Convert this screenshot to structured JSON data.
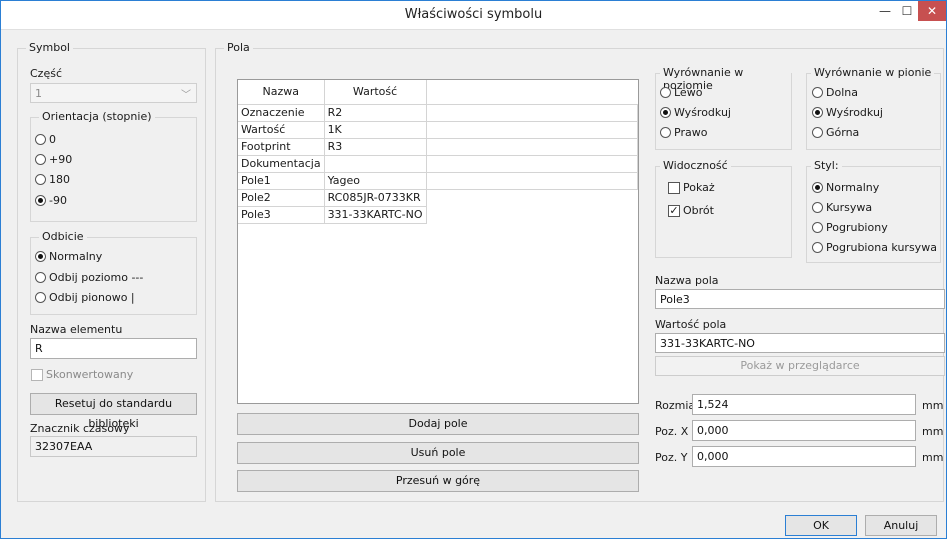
{
  "window": {
    "title": "Właściwości symbolu"
  },
  "symbol": {
    "group_label": "Symbol",
    "part_label": "Część",
    "part_value": "1",
    "orientation": {
      "label": "Orientacja (stopnie)",
      "options": [
        "0",
        "+90",
        "180",
        "-90"
      ],
      "selected": "-90"
    },
    "mirror": {
      "label": "Odbicie",
      "options": [
        "Normalny",
        "Odbij poziomo ---",
        "Odbij pionowo |"
      ],
      "selected": "Normalny"
    },
    "element_name_label": "Nazwa elementu",
    "element_name_value": "R",
    "converted_label": "Skonwertowany",
    "reset_button": "Resetuj do standardu biblioteki",
    "timestamp_label": "Znacznik czasowy",
    "timestamp_value": "32307EAA"
  },
  "fields": {
    "group_label": "Pola",
    "columns": [
      "Nazwa",
      "Wartość"
    ],
    "rows": [
      {
        "name": "Oznaczenie",
        "value": "R2"
      },
      {
        "name": "Wartość",
        "value": "1K"
      },
      {
        "name": "Footprint",
        "value": "R3"
      },
      {
        "name": "Dokumentacja",
        "value": ""
      },
      {
        "name": "Pole1",
        "value": "Yageo"
      },
      {
        "name": "Pole2",
        "value": "RC085JR-0733KR"
      },
      {
        "name": "Pole3",
        "value": "331-33KARTC-NO"
      }
    ],
    "add_button": "Dodaj pole",
    "remove_button": "Usuń pole",
    "move_up_button": "Przesuń w górę"
  },
  "halign": {
    "label": "Wyrównanie w poziomie",
    "options": [
      "Lewo",
      "Wyśrodkuj",
      "Prawo"
    ],
    "selected": "Wyśrodkuj"
  },
  "valign": {
    "label": "Wyrównanie w pionie",
    "options": [
      "Dolna",
      "Wyśrodkuj",
      "Górna"
    ],
    "selected": "Wyśrodkuj"
  },
  "visibility": {
    "label": "Widoczność",
    "show_label": "Pokaż",
    "show_checked": false,
    "rotate_label": "Obrót",
    "rotate_checked": true
  },
  "style": {
    "label": "Styl:",
    "options": [
      "Normalny",
      "Kursywa",
      "Pogrubiony",
      "Pogrubiona kursywa"
    ],
    "selected": "Normalny"
  },
  "field_name": {
    "label": "Nazwa pola",
    "value": "Pole3"
  },
  "field_value": {
    "label": "Wartość pola",
    "value": "331-33KARTC-NO"
  },
  "browser_button": "Pokaż w przeglądarce",
  "size": {
    "label": "Rozmiar",
    "value": "1,524",
    "unit": "mm"
  },
  "posx": {
    "label": "Poz. X",
    "value": "0,000",
    "unit": "mm"
  },
  "posy": {
    "label": "Poz. Y",
    "value": "0,000",
    "unit": "mm"
  },
  "ok_button": "OK",
  "cancel_button": "Anuluj",
  "icons": {
    "minimize": "—",
    "maximize": "☐",
    "close": "✕",
    "dropdown": "﹀",
    "check": "✓"
  }
}
